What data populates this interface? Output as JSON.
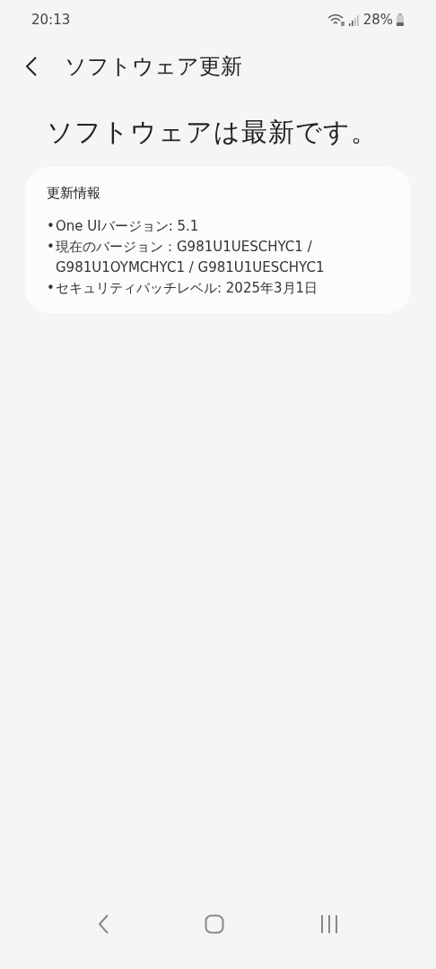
{
  "status_bar": {
    "time": "20:13",
    "battery": "28%"
  },
  "header": {
    "title": "ソフトウェア更新"
  },
  "headline": "ソフトウェアは最新です。",
  "card": {
    "title": "更新情報",
    "items": [
      {
        "bullet": "•",
        "text": "One UIバージョン: 5.1"
      },
      {
        "bullet": "•",
        "text": "現在のバージョン：G981U1UESCHYC1 / G981U1OYMCHYC1 / G981U1UESCHYC1"
      },
      {
        "bullet": "•",
        "text": "セキュリティパッチレベル: 2025年3月1日"
      }
    ]
  }
}
